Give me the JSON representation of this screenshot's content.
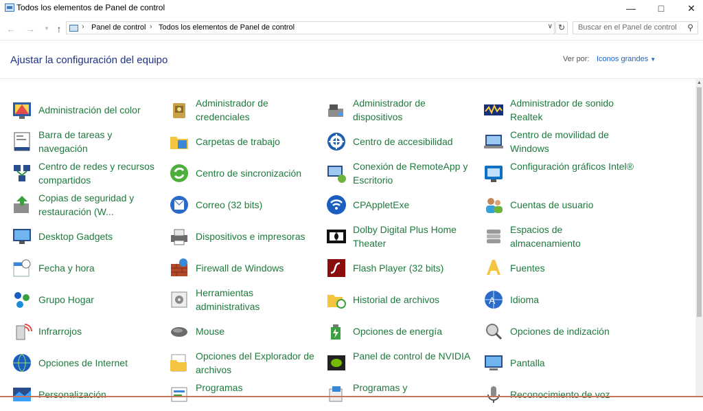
{
  "window": {
    "title": "Todos los elementos de Panel de control"
  },
  "addressbar": {
    "breadcrumb": [
      "Panel de control",
      "Todos los elementos de Panel de control"
    ],
    "search_placeholder": "Buscar en el Panel de control"
  },
  "header": {
    "title": "Ajustar la configuración del equipo",
    "view_by_label": "Ver por:",
    "view_by_value": "Iconos grandes"
  },
  "items": [
    {
      "label": "Administración del color",
      "icon": "color-management-icon"
    },
    {
      "label": "Administrador de credenciales",
      "icon": "credential-manager-icon"
    },
    {
      "label": "Administrador de dispositivos",
      "icon": "device-manager-icon"
    },
    {
      "label": "Administrador de sonido Realtek",
      "icon": "realtek-audio-icon"
    },
    {
      "label": "Barra de tareas y navegación",
      "icon": "taskbar-icon"
    },
    {
      "label": "Carpetas de trabajo",
      "icon": "work-folders-icon"
    },
    {
      "label": "Centro de accesibilidad",
      "icon": "accessibility-icon"
    },
    {
      "label": "Centro de movilidad de Windows",
      "icon": "mobility-center-icon"
    },
    {
      "label": "Centro de redes y recursos compartidos",
      "icon": "network-center-icon"
    },
    {
      "label": "Centro de sincronización",
      "icon": "sync-center-icon"
    },
    {
      "label": "Conexión de RemoteApp y Escritorio",
      "icon": "remoteapp-icon"
    },
    {
      "label": "Configuración gráficos Intel®",
      "icon": "intel-graphics-icon"
    },
    {
      "label": "Copias de seguridad y restauración (W...",
      "icon": "backup-restore-icon"
    },
    {
      "label": "Correo (32 bits)",
      "icon": "mail-icon"
    },
    {
      "label": "CPAppletExe",
      "icon": "wireless-icon"
    },
    {
      "label": "Cuentas de usuario",
      "icon": "user-accounts-icon"
    },
    {
      "label": "Desktop Gadgets",
      "icon": "desktop-gadgets-icon"
    },
    {
      "label": "Dispositivos e impresoras",
      "icon": "printer-icon"
    },
    {
      "label": "Dolby Digital Plus Home Theater",
      "icon": "dolby-icon"
    },
    {
      "label": "Espacios de almacenamiento",
      "icon": "storage-spaces-icon"
    },
    {
      "label": "Fecha y hora",
      "icon": "date-time-icon"
    },
    {
      "label": "Firewall de Windows",
      "icon": "firewall-icon"
    },
    {
      "label": "Flash Player (32 bits)",
      "icon": "flash-player-icon"
    },
    {
      "label": "Fuentes",
      "icon": "fonts-icon"
    },
    {
      "label": "Grupo Hogar",
      "icon": "homegroup-icon"
    },
    {
      "label": "Herramientas administrativas",
      "icon": "admin-tools-icon"
    },
    {
      "label": "Historial de archivos",
      "icon": "file-history-icon"
    },
    {
      "label": "Idioma",
      "icon": "language-icon"
    },
    {
      "label": "Infrarrojos",
      "icon": "infrared-icon"
    },
    {
      "label": "Mouse",
      "icon": "mouse-icon"
    },
    {
      "label": "Opciones de energía",
      "icon": "power-options-icon"
    },
    {
      "label": "Opciones de indización",
      "icon": "indexing-options-icon"
    },
    {
      "label": "Opciones de Internet",
      "icon": "internet-options-icon"
    },
    {
      "label": "Opciones del Explorador de archivos",
      "icon": "explorer-options-icon"
    },
    {
      "label": "Panel de control de NVIDIA",
      "icon": "nvidia-icon"
    },
    {
      "label": "Pantalla",
      "icon": "display-icon"
    },
    {
      "label": "Personalización",
      "icon": "personalization-icon"
    },
    {
      "label": "Programas",
      "icon": "programs-icon"
    },
    {
      "label": "Programas y",
      "icon": "programs-features-icon"
    },
    {
      "label": "Reconocimiento de voz",
      "icon": "speech-recognition-icon"
    }
  ],
  "colors": {
    "link": "#1e7a3c",
    "header": "#1e3287",
    "accent": "#1e64c8"
  }
}
